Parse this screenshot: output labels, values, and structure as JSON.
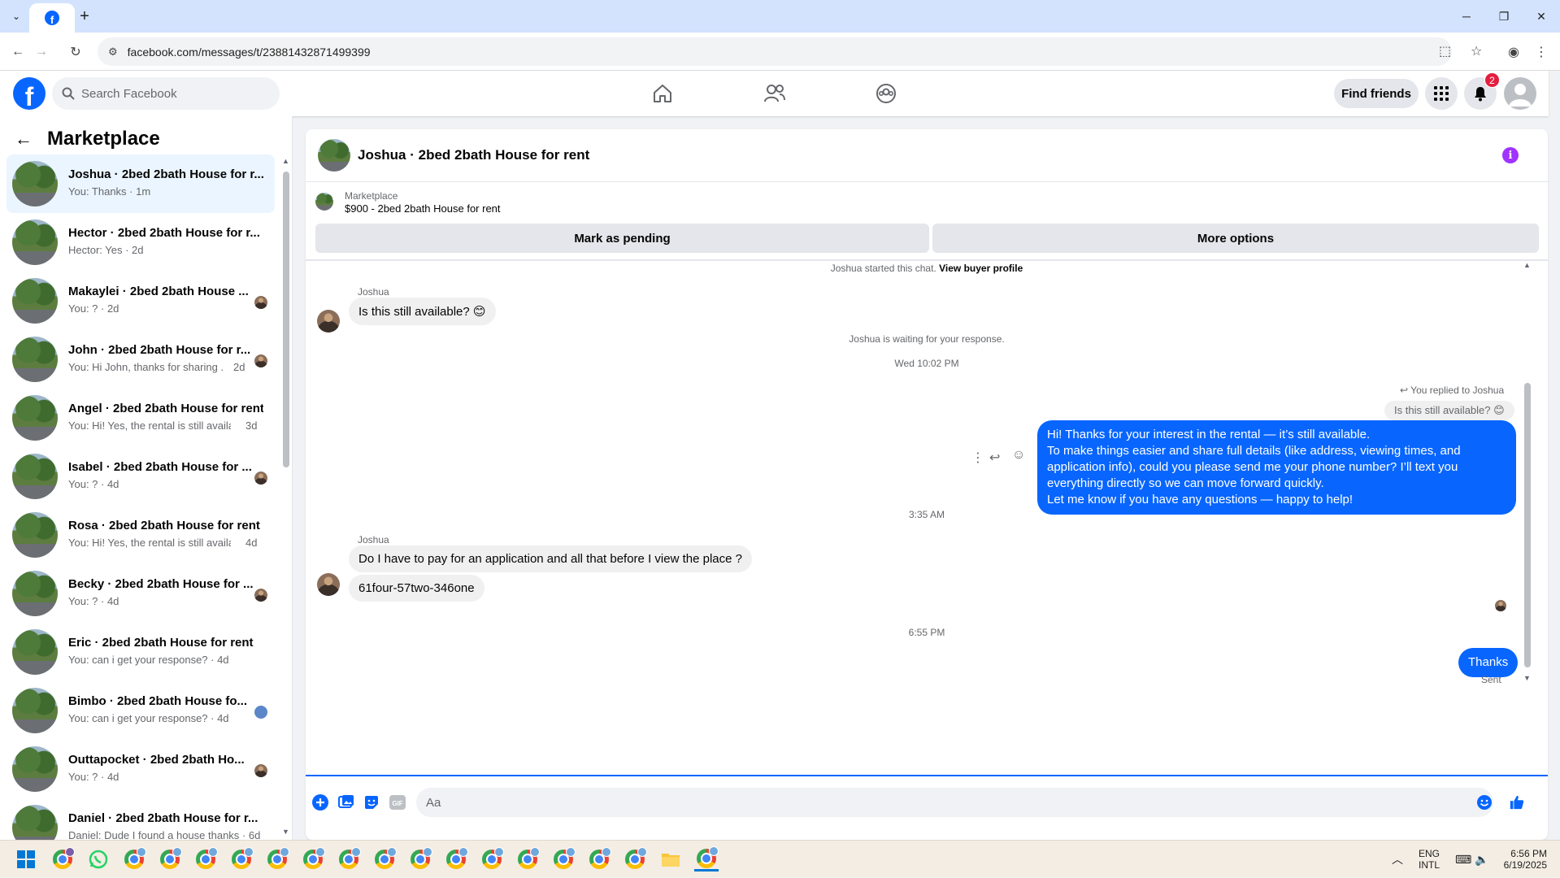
{
  "browser": {
    "url": "facebook.com/messages/t/23881432871499399"
  },
  "header": {
    "search_placeholder": "Search Facebook",
    "find_friends": "Find friends",
    "notif_count": "2"
  },
  "sidebar": {
    "title": "Marketplace",
    "conversations": [
      {
        "title": "Joshua · 2bed 2bath House for r...",
        "sub": "You: Thanks · 1m",
        "active": true
      },
      {
        "title": "Hector · 2bed 2bath House for r...",
        "sub": "Hector: Yes · 2d"
      },
      {
        "title": "Makaylei · 2bed 2bath House ...",
        "sub": "You: ? · 2d"
      },
      {
        "title": "John · 2bed 2bath House for r...",
        "sub": "You: Hi John, thanks for sharing ...",
        "time": "2d"
      },
      {
        "title": "Angel · 2bed 2bath House for rent",
        "sub": "You: Hi! Yes, the rental is still availa...",
        "time": "3d"
      },
      {
        "title": "Isabel · 2bed 2bath House for ...",
        "sub": "You: ? · 4d"
      },
      {
        "title": "Rosa · 2bed 2bath House for rent",
        "sub": "You: Hi! Yes, the rental is still availa...",
        "time": "4d"
      },
      {
        "title": "Becky · 2bed 2bath House for ...",
        "sub": "You: ? · 4d"
      },
      {
        "title": "Eric · 2bed 2bath House for rent",
        "sub": "You: can i get your response? · 4d"
      },
      {
        "title": "Bimbo · 2bed 2bath House fo...",
        "sub": "You: can i get your response? · 4d"
      },
      {
        "title": "Outtapocket · 2bed 2bath Ho...",
        "sub": "You: ? · 4d"
      },
      {
        "title": "Daniel · 2bed 2bath House for r...",
        "sub": "Daniel: Dude I found a house thanks · 6d"
      }
    ]
  },
  "chat": {
    "title": "Joshua · 2bed 2bath House for rent",
    "listing_source": "Marketplace",
    "listing_price_title": "$900 - 2bed 2bath House for rent",
    "mark_pending": "Mark as pending",
    "more_options": "More options",
    "started_note": "Joshua started this chat.",
    "view_profile": "View buyer profile",
    "sender_name": "Joshua",
    "msg1": "Is this still available? 😊",
    "waiting_note": "Joshua is waiting for your response.",
    "time1": "Wed 10:02 PM",
    "replied_label": "You replied to Joshua",
    "reply_quote": "Is this still available? 😊",
    "out_lines": [
      "Hi! Thanks for your interest in the rental — it’s still available.",
      "To make things easier and share full details (like address, viewing times, and",
      "application info), could you please send me your phone number? I’ll text you",
      "everything directly so we can move forward quickly.",
      "Let me know if you have any questions — happy to help!"
    ],
    "time2": "3:35 AM",
    "sender_name2": "Joshua",
    "msg2": "Do I have to pay for an application and all that before I view the place ?",
    "msg3": "61four-57two-346one",
    "time3": "6:55 PM",
    "out_thanks": "Thanks",
    "sent_label": "Sent",
    "composer_placeholder": "Aa"
  },
  "taskbar": {
    "lang1": "ENG",
    "lang2": "INTL",
    "clock_time": "6:56 PM",
    "clock_date": "6/19/2025"
  },
  "colors": {
    "accent": "#0866ff",
    "info": "#a033ff",
    "badge": "#e41e3f"
  }
}
